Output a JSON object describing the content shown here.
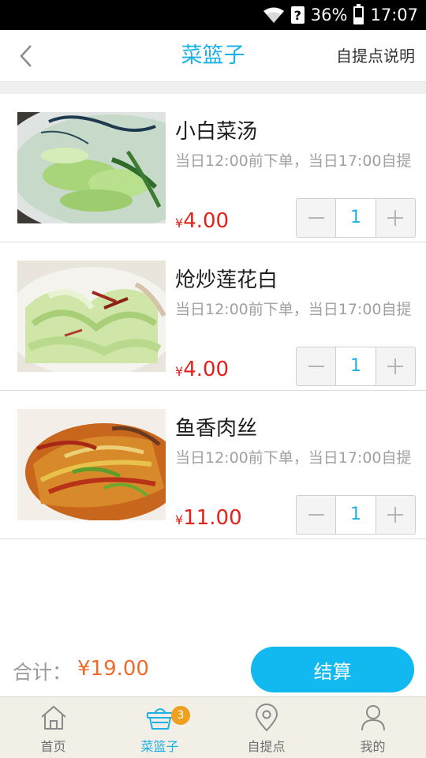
{
  "status_bar": {
    "battery": "36%",
    "time": "17:07",
    "battery_level": 0.36
  },
  "nav": {
    "title": "菜篮子",
    "right_action": "自提点说明"
  },
  "items": [
    {
      "name": "小白菜汤",
      "desc": "当日12:00前下单，当日17:00自提",
      "currency": "¥",
      "price": "4.00",
      "qty": "1"
    },
    {
      "name": "炝炒莲花白",
      "desc": "当日12:00前下单，当日17:00自提",
      "currency": "¥",
      "price": "4.00",
      "qty": "1"
    },
    {
      "name": "鱼香肉丝",
      "desc": "当日12:00前下单，当日17:00自提",
      "currency": "¥",
      "price": "11.00",
      "qty": "1"
    }
  ],
  "summary": {
    "total_label": "合计：",
    "total_amount": "¥19.00",
    "checkout_label": "结算"
  },
  "tabs": [
    {
      "label": "首页",
      "icon": "home-icon"
    },
    {
      "label": "菜篮子",
      "icon": "basket-icon",
      "badge": "3",
      "active": true
    },
    {
      "label": "自提点",
      "icon": "location-icon"
    },
    {
      "label": "我的",
      "icon": "user-icon"
    }
  ],
  "colors": {
    "accent": "#1bb1e6",
    "price": "#e1231c",
    "total": "#f06a2a",
    "badge": "#f0a020"
  }
}
